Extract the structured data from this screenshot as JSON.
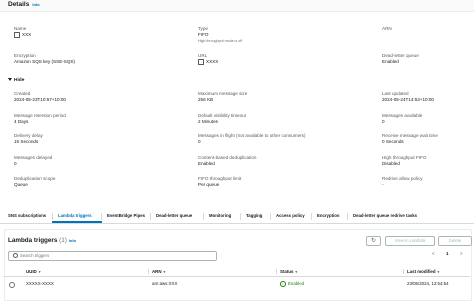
{
  "header": {
    "title": "Details",
    "info": "Info"
  },
  "details": {
    "name": {
      "label": "Name",
      "value": "XXX"
    },
    "type": {
      "label": "Type",
      "value": "FIFO",
      "note": "High throughput mode is off"
    },
    "arn": {
      "label": "ARN",
      "value": ""
    },
    "encryption": {
      "label": "Encryption",
      "value": "Amazon SQS key (SSE-SQS)"
    },
    "url": {
      "label": "URL",
      "value": "XXXX"
    },
    "dlq": {
      "label": "Dead-letter queue",
      "value": "Enabled"
    },
    "hide_label": "Hide",
    "created": {
      "label": "Created",
      "value": "2024-05-23T10:57+10:00"
    },
    "max_msg": {
      "label": "Maximum message size",
      "value": "256 KB"
    },
    "last_updated": {
      "label": "Last updated",
      "value": "2024-05-24T14:53+10:00"
    },
    "retention": {
      "label": "Message retention period",
      "value": "4 Days"
    },
    "visibility": {
      "label": "Default visibility timeout",
      "value": "2 Minutes"
    },
    "available": {
      "label": "Messages available",
      "value": "0"
    },
    "delivery_delay": {
      "label": "Delivery delay",
      "value": "15 Seconds"
    },
    "in_flight": {
      "label": "Messages in flight (not available to other consumers)",
      "value": "0"
    },
    "wait_time": {
      "label": "Receive message wait time",
      "value": "0 Seconds"
    },
    "delayed": {
      "label": "Messages delayed",
      "value": "0"
    },
    "dedup": {
      "label": "Content-based deduplication",
      "value": "Enabled"
    },
    "ht_fifo": {
      "label": "High throughput FIFO",
      "value": "Disabled"
    },
    "dedup_scope": {
      "label": "Deduplication scope",
      "value": "Queue"
    },
    "fifo_limit": {
      "label": "FIFO throughput limit",
      "value": "Per queue"
    },
    "redrive": {
      "label": "Redrive allow policy",
      "value": "-"
    }
  },
  "tabs": [
    "SNS subscriptions",
    "Lambda triggers",
    "EventBridge Pipes",
    "Dead-letter queue",
    "Monitoring",
    "Tagging",
    "Access policy",
    "Encryption",
    "Dead-letter queue redrive tasks"
  ],
  "active_tab": "Lambda triggers",
  "triggers": {
    "title": "Lambda triggers",
    "count": "(1)",
    "info": "Info",
    "refresh_icon": "refresh-icon",
    "view_label": "View in Lambda",
    "delete_label": "Delete",
    "search_placeholder": "Search triggers",
    "page_prev": "<",
    "page_num": "1",
    "page_next": ">",
    "columns": {
      "uuid": "UUID",
      "arn": "ARN",
      "status": "Status",
      "last_modified": "Last modified"
    },
    "rows": [
      {
        "uuid": "XXXXX-XXXX",
        "arn": "arn:aws:XXX",
        "status": "Enabled",
        "last_modified": "23/05/2024, 12:54:54"
      }
    ]
  },
  "colors": {
    "accent": "#0073bb",
    "success": "#1d8102"
  }
}
